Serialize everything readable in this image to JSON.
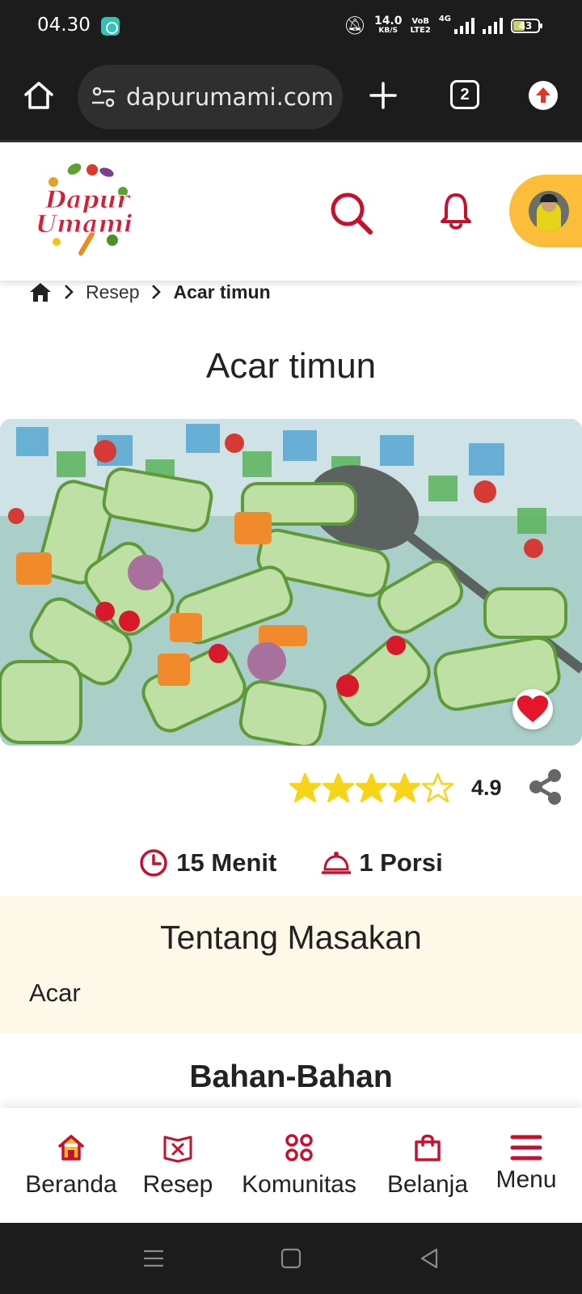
{
  "status_bar": {
    "time": "04.30",
    "net_speed_value": "14.0",
    "net_speed_unit": "KB/S",
    "volte_top": "VoB",
    "volte_bottom": "LTE2",
    "network": "4G",
    "battery": "43"
  },
  "browser": {
    "url": "dapurumami.com",
    "tab_count": "2"
  },
  "header": {
    "logo_text_1": "Dapur",
    "logo_text_2": "Umami"
  },
  "breadcrumb": {
    "item": "Resep",
    "current": "Acar timun"
  },
  "recipe": {
    "title": "Acar timun",
    "rating": "4.9",
    "rating_stars": 4.9,
    "time": "15 Menit",
    "portion": "1 Porsi"
  },
  "about": {
    "title": "Tentang Masakan",
    "text": "Acar"
  },
  "ingredients": {
    "title": "Bahan-Bahan"
  },
  "bottom_nav": {
    "items": [
      {
        "label": "Beranda",
        "icon": "home-icon"
      },
      {
        "label": "Resep",
        "icon": "recipe-book-icon"
      },
      {
        "label": "Komunitas",
        "icon": "community-icon"
      },
      {
        "label": "Belanja",
        "icon": "shopping-bag-icon"
      },
      {
        "label": "Menu",
        "icon": "hamburger-menu-icon"
      }
    ]
  },
  "colors": {
    "brand_red": "#c8102e",
    "accent_yellow": "#fbbd3a",
    "star_yellow": "#f7d417",
    "about_bg": "#fdf8e7"
  }
}
